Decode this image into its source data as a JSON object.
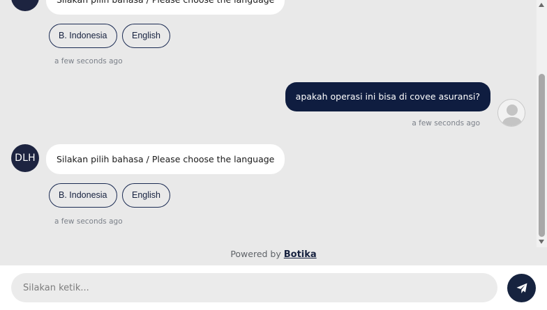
{
  "messages": [
    {
      "sender": "bot",
      "avatar": "DLH",
      "text": "Silakan pilih bahasa / Please choose the language",
      "options": [
        "B. Indonesia",
        "English"
      ],
      "time": "a few seconds ago"
    },
    {
      "sender": "user",
      "avatar_icon": "user-silhouette-icon",
      "text": "apakah operasi ini bisa di covee asuransi?",
      "time": "a few seconds ago"
    },
    {
      "sender": "bot",
      "avatar": "DLH",
      "text": "Silakan pilih bahasa / Please choose the language",
      "options": [
        "B. Indonesia",
        "English"
      ],
      "time": "a few seconds ago"
    }
  ],
  "footer": {
    "powered_by": "Powered by",
    "brand": "Botika"
  },
  "composer": {
    "placeholder": "Silakan ketik...",
    "send_icon": "paper-plane-icon"
  },
  "colors": {
    "chat_background": "#e9e9e9",
    "bot_avatar": "#1d2440",
    "user_bubble": "#0f1d40",
    "accent": "#16233f"
  }
}
